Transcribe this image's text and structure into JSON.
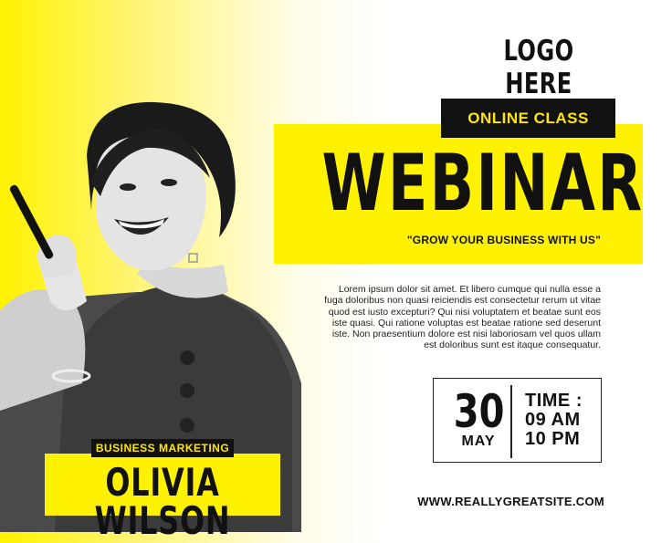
{
  "logo": {
    "text": "LOGO HERE"
  },
  "hero": {
    "tag": "ONLINE CLASS",
    "title": "WEBINAR",
    "tagline": "\"GROW YOUR BUSINESS WITH US\""
  },
  "description": "Lorem ipsum dolor sit amet. Et libero cumque qui nulla esse a fuga doloribus non quasi reiciendis est consectetur rerum ut vitae quod est iusto excepturi? Qui nisi voluptatem et beatae sunt eos iste quasi. Qui ratione voluptas est beatae ratione sed deserunt iste. Non praesentium dolore est nisi laboriosam vel quos ullam est doloribus sunt est itaque consequatur.",
  "event": {
    "day": "30",
    "month": "MAY",
    "time_label": "TIME :",
    "time_start": "09 AM",
    "time_end": "10 PM"
  },
  "website": "WWW.REALLYGREATSITE.COM",
  "speaker": {
    "role": "BUSINESS MARKETING",
    "name": "OLIVIA WILSON"
  },
  "colors": {
    "accent": "#fff200",
    "dark": "#111111",
    "tag_text": "#ffe600"
  }
}
